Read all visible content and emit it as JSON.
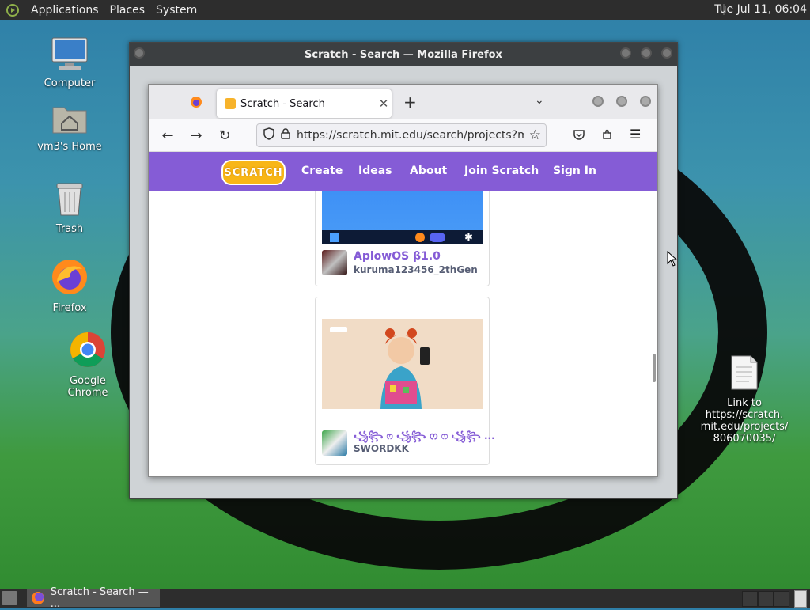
{
  "top_panel": {
    "menus": [
      "Applications",
      "Places",
      "System"
    ],
    "clock": "Tue Jul 11, 06:04"
  },
  "desktop_icons": {
    "computer": "Computer",
    "home": "vm3's Home",
    "trash": "Trash",
    "firefox": "Firefox",
    "chrome": "Google Chrome",
    "link_line1": "Link to https://scratch.",
    "link_line2": "mit.edu/projects/",
    "link_line3": "806070035/"
  },
  "outer_window": {
    "title": "Scratch - Search — Mozilla Firefox"
  },
  "browser": {
    "tab_title": "Scratch - Search",
    "url": "https://scratch.mit.edu/search/projects?mo"
  },
  "scratch_nav": {
    "logo": "SCRATCH",
    "items": [
      "Create",
      "Ideas",
      "About",
      "Join Scratch",
      "Sign In"
    ]
  },
  "projects": [
    {
      "title": "AplowOS β1.0",
      "author": "kuruma123456_2thGen"
    },
    {
      "title": "꧁꧂ ෆ ꧁꧂ ᰔ ෆ ꧁꧂ ...",
      "author": "SWORDKK"
    }
  ],
  "taskbar": {
    "task_label": "Scratch - Search — ..."
  },
  "colors": {
    "scratch_purple": "#855cd6",
    "scratch_orange": "#f8b617"
  }
}
